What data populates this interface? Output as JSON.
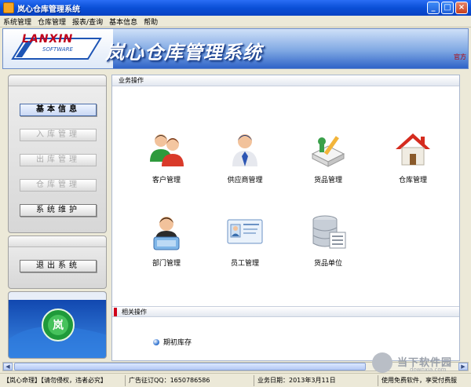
{
  "window": {
    "title": "岚心仓库管理系统",
    "controls": {
      "minimize": "_",
      "maximize": "□",
      "close": "×"
    }
  },
  "menu": [
    "系统管理",
    "仓库管理",
    "报表/查询",
    "基本信息",
    "帮助"
  ],
  "banner": {
    "logo_text": "LANXIN",
    "logo_sub": "SOFTWARE",
    "title": "岚心仓库管理系统",
    "right_text": "官方"
  },
  "sidebar": {
    "buttons": [
      {
        "label": "基本信息",
        "state": "active"
      },
      {
        "label": "入库管理",
        "state": "disabled"
      },
      {
        "label": "出库管理",
        "state": "disabled"
      },
      {
        "label": "仓库管理",
        "state": "disabled"
      },
      {
        "label": "系统维护",
        "state": "normal"
      }
    ],
    "exit_button": "退出系统"
  },
  "main": {
    "section_title": "业务操作",
    "operations": [
      {
        "label": "客户管理",
        "icon": "users-icon"
      },
      {
        "label": "供应商管理",
        "icon": "supplier-icon"
      },
      {
        "label": "货品管理",
        "icon": "goods-icon"
      },
      {
        "label": "仓库管理",
        "icon": "warehouse-icon"
      },
      {
        "label": "部门管理",
        "icon": "department-icon"
      },
      {
        "label": "员工管理",
        "icon": "employee-card-icon"
      },
      {
        "label": "货品单位",
        "icon": "database-icon"
      }
    ],
    "related_title": "相关操作",
    "related_items": [
      "期初库存"
    ]
  },
  "status": [
    "【岚心命理】【请勿侵权，违者必究】",
    "广告征订QQ：1650786586",
    "业务日期：2013年3月11日",
    "使用免费软件，享受付费服"
  ],
  "watermark": {
    "text": "当下软件园",
    "sub": "downxia.com"
  },
  "colors": {
    "titlebar": "#0a4fd6",
    "banner_text": "#ffffff",
    "logo_red": "#c0001a",
    "accent_red": "#d0001a"
  }
}
